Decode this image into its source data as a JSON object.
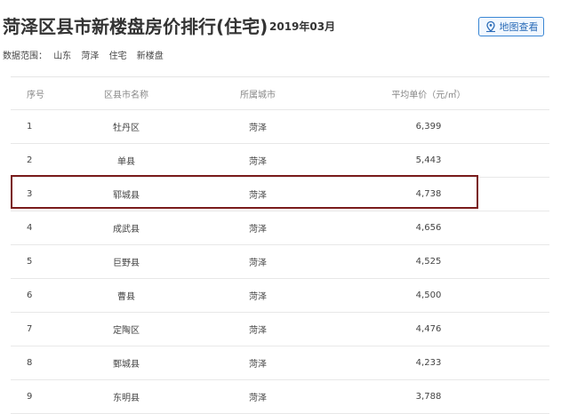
{
  "header": {
    "title": "菏泽区县市新楼盘房价排行(住宅)",
    "date": "2019年03月",
    "map_button": "地图查看"
  },
  "scope": {
    "label": "数据范围：",
    "tags": [
      "山东",
      "菏泽",
      "住宅",
      "新楼盘"
    ]
  },
  "table": {
    "columns": [
      "序号",
      "区县市名称",
      "所属城市",
      "平均单价（元/㎡）"
    ],
    "rows": [
      {
        "rank": "1",
        "name": "牡丹区",
        "city": "菏泽",
        "price": "6,399"
      },
      {
        "rank": "2",
        "name": "单县",
        "city": "菏泽",
        "price": "5,443"
      },
      {
        "rank": "3",
        "name": "郓城县",
        "city": "菏泽",
        "price": "4,738"
      },
      {
        "rank": "4",
        "name": "成武县",
        "city": "菏泽",
        "price": "4,656"
      },
      {
        "rank": "5",
        "name": "巨野县",
        "city": "菏泽",
        "price": "4,525"
      },
      {
        "rank": "6",
        "name": "曹县",
        "city": "菏泽",
        "price": "4,500"
      },
      {
        "rank": "7",
        "name": "定陶区",
        "city": "菏泽",
        "price": "4,476"
      },
      {
        "rank": "8",
        "name": "鄄城县",
        "city": "菏泽",
        "price": "4,233"
      },
      {
        "rank": "9",
        "name": "东明县",
        "city": "菏泽",
        "price": "3,788"
      }
    ]
  },
  "colors": {
    "highlight_border": "#7a1c1c",
    "button_border": "#3a86d4",
    "button_text": "#2b6cb8"
  }
}
